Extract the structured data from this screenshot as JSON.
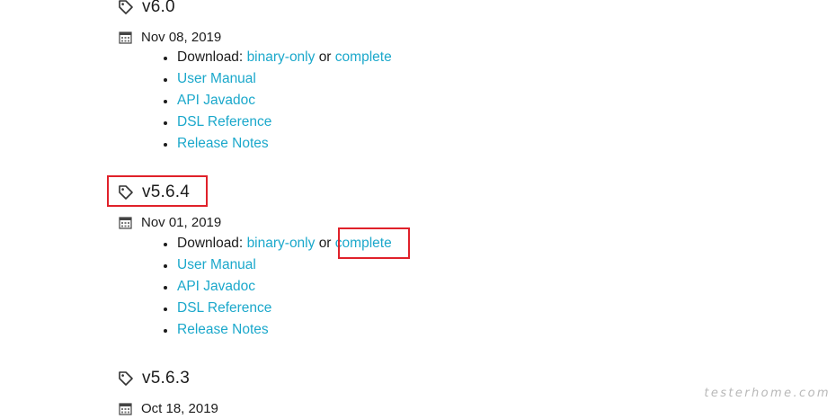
{
  "releases": [
    {
      "version": "v6.0",
      "date": "Nov 08, 2019",
      "download_prefix": "Download:",
      "binary_only": "binary-only",
      "or": "or",
      "complete": "complete",
      "user_manual": "User Manual",
      "api_javadoc": "API Javadoc",
      "dsl_reference": "DSL Reference",
      "release_notes": "Release Notes"
    },
    {
      "version": "v5.6.4",
      "date": "Nov 01, 2019",
      "download_prefix": "Download:",
      "binary_only": "binary-only",
      "or": "or",
      "complete": "complete",
      "user_manual": "User Manual",
      "api_javadoc": "API Javadoc",
      "dsl_reference": "DSL Reference",
      "release_notes": "Release Notes"
    },
    {
      "version": "v5.6.3",
      "date": "Oct 18, 2019"
    }
  ],
  "watermark": "testerhome.com",
  "colors": {
    "link": "#1ba8cb",
    "text": "#1c1c1c",
    "highlight": "#e0212a"
  },
  "icons": {
    "tag": "tag-icon",
    "calendar": "calendar-icon"
  }
}
